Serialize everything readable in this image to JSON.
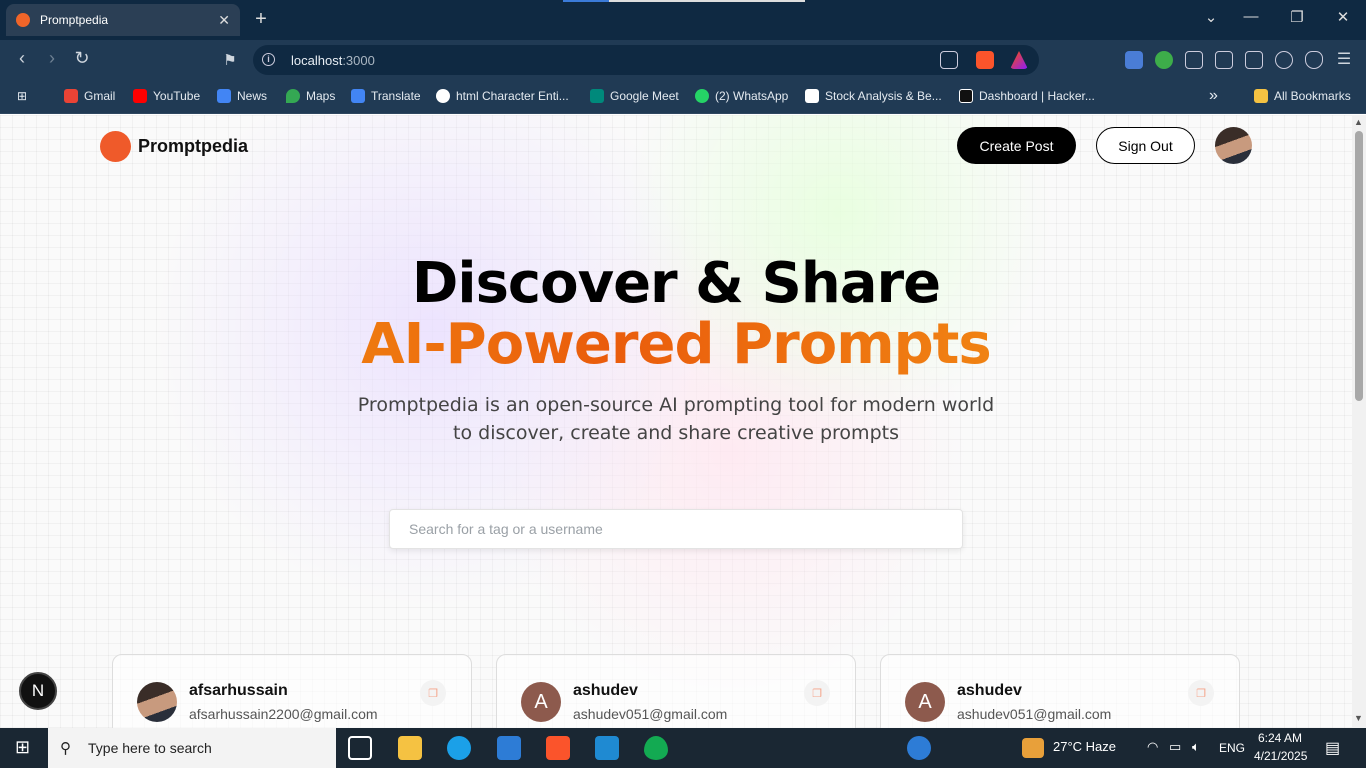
{
  "browser": {
    "tab_title": "Promptpedia",
    "tab_close": "✕",
    "new_tab": "+",
    "url_host": "localhost",
    "url_port": ":3000",
    "window_controls": [
      "⌄",
      "—",
      "❐",
      "✕"
    ]
  },
  "bookmarks": [
    {
      "label": "Gmail",
      "icon": "gmail-icon",
      "color": "#ea4335"
    },
    {
      "label": "YouTube",
      "icon": "youtube-icon",
      "color": "#ff0000"
    },
    {
      "label": "News",
      "icon": "news-icon",
      "color": "#4285f4"
    },
    {
      "label": "Maps",
      "icon": "maps-icon",
      "color": "#34a853"
    },
    {
      "label": "Translate",
      "icon": "translate-icon",
      "color": "#4285f4"
    },
    {
      "label": "html Character Enti...",
      "icon": "question-icon",
      "color": "#ffffff"
    },
    {
      "label": "Google Meet",
      "icon": "meet-icon",
      "color": "#00897b"
    },
    {
      "label": "(2) WhatsApp",
      "icon": "whatsapp-icon",
      "color": "#25d366"
    },
    {
      "label": "Stock Analysis & Be...",
      "icon": "stock-icon",
      "color": "#222222"
    },
    {
      "label": "Dashboard | Hacker...",
      "icon": "hackerrank-icon",
      "color": "#111111"
    }
  ],
  "bookmarks_more": "»",
  "all_bookmarks": "All Bookmarks",
  "page": {
    "brand": "Promptpedia",
    "create_post": "Create Post",
    "sign_out": "Sign Out",
    "heading_line1": "Discover & Share",
    "heading_line2": "AI-Powered Prompts",
    "description": "Promptpedia is an open-source AI prompting tool for modern world to discover, create and share creative prompts",
    "search_placeholder": "Search for a tag or a username",
    "search_value": "",
    "next_badge": "N"
  },
  "cards": [
    {
      "username": "afsarhussain",
      "email": "afsarhussain2200@gmail.com",
      "avatar_letter": ""
    },
    {
      "username": "ashudev",
      "email": "ashudev051@gmail.com",
      "avatar_letter": "A"
    },
    {
      "username": "ashudev",
      "email": "ashudev051@gmail.com",
      "avatar_letter": "A"
    }
  ],
  "taskbar": {
    "search_placeholder": "Type here to search",
    "weather": "27°C  Haze",
    "language": "ENG",
    "time": "6:24 AM",
    "date": "4/21/2025"
  },
  "colors": {
    "accent_orange": "#ea5c0c",
    "accent_gold": "#f5a414",
    "browser_bg": "#0f2942"
  }
}
